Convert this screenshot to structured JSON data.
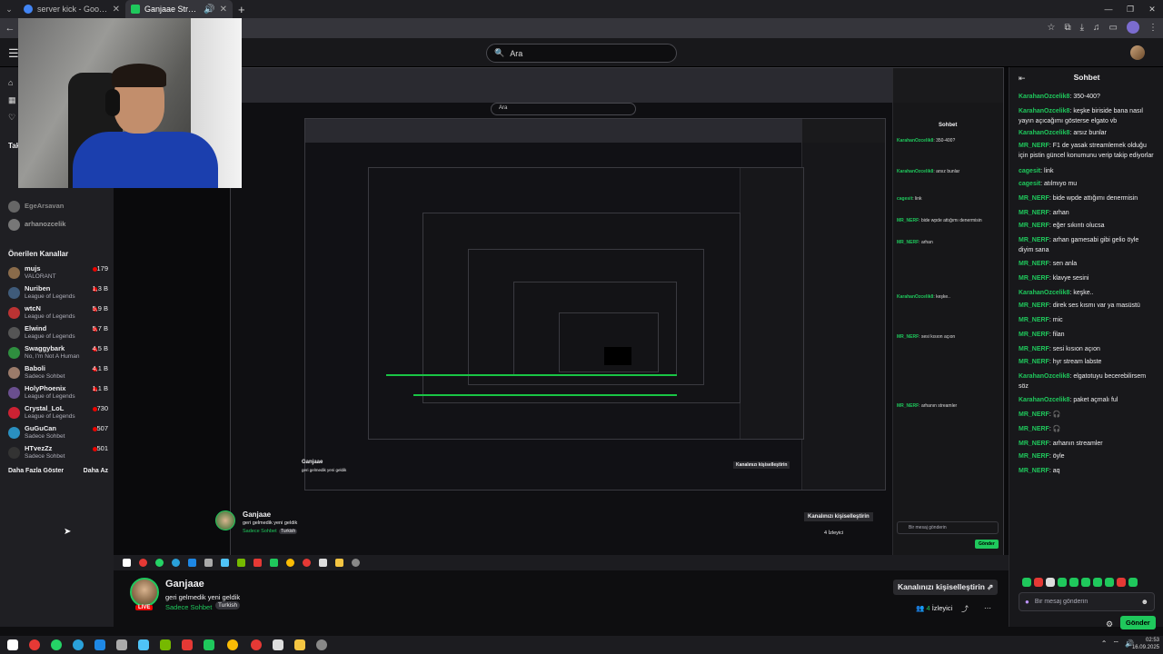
{
  "browser": {
    "tabs": [
      {
        "label": "server kick - Google'da Ara",
        "color": "#4285f4",
        "active": false
      },
      {
        "label": "Ganjaae Stream - Watch Live",
        "color": "#1fc85c",
        "active": true
      }
    ],
    "new_tab": "+",
    "win_minimize": "—",
    "win_maximize": "❐",
    "win_close": "✕"
  },
  "topbar": {
    "search_placeholder": "Ara"
  },
  "sidebar": {
    "following_heading": "Tak",
    "followed": [
      {
        "name": "EgeArsavan",
        "color": "#888"
      },
      {
        "name": "arhanozcelik",
        "color": "#999"
      }
    ],
    "recommended_heading": "Önerilen Kanallar",
    "channels": [
      {
        "name": "mujs",
        "category": "VALORANT",
        "viewers": "179",
        "color": "#8a6b4a"
      },
      {
        "name": "Nuriben",
        "category": "League of Legends",
        "viewers": "1,3 B",
        "color": "#3f5b7a"
      },
      {
        "name": "wtcN",
        "category": "League of Legends",
        "viewers": "5,9 B",
        "color": "#b33"
      },
      {
        "name": "Elwind",
        "category": "League of Legends",
        "viewers": "5,7 B",
        "color": "#555"
      },
      {
        "name": "Swaggybark",
        "category": "No, I'm Not A Human",
        "viewers": "4,5 B",
        "color": "#2f8f3f"
      },
      {
        "name": "Baboli",
        "category": "Sadece Sohbet",
        "viewers": "4,1 B",
        "color": "#9b7b6a"
      },
      {
        "name": "HolyPhoenix",
        "category": "League of Legends",
        "viewers": "1,1 B",
        "color": "#6a4f8f"
      },
      {
        "name": "Crystal_LoL",
        "category": "League of Legends",
        "viewers": "730",
        "color": "#c23"
      },
      {
        "name": "GuGuCan",
        "category": "Sadece Sohbet",
        "viewers": "507",
        "color": "#2a8fbf"
      },
      {
        "name": "HTvezZz",
        "category": "Sadece Sohbet",
        "viewers": "501",
        "color": "#333"
      }
    ],
    "show_more": "Daha Fazla Göster",
    "show_less": "Daha Az"
  },
  "stream_inner": {
    "search": "Ara",
    "chat_head": "Sohbet",
    "channel_name": "Ganjaae",
    "title": "geri gelmedik yeni geldik",
    "category": "Sadece Sohbet",
    "tag": "Turkish",
    "customize": "Kanalınızı kişiselleştirin",
    "viewers": "4 İzleyici",
    "input_placeholder": "Bir mesaj gönderin",
    "send": "Gönder"
  },
  "channel_info": {
    "name": "Ganjaae",
    "title": "geri gelmedik yeni geldik",
    "category": "Sadece Sohbet",
    "tag": "Turkish",
    "live": "LIVE",
    "customize_button": "Kanalınızı kişiselleştirin ⇗",
    "viewer_count": "4",
    "viewer_label": "İzleyici"
  },
  "chat": {
    "heading": "Sohbet",
    "messages": [
      {
        "user": "KarahanOzcelik8",
        "text": "350-400?"
      },
      {
        "user": "KarahanOzcelik8",
        "text": "keşke biriside bana nasıl yayın açıcağımı gösterse elgato vb"
      },
      {
        "user": "KarahanOzcelik8",
        "text": "arsız bunlar"
      },
      {
        "user": "MR_NERF",
        "text": "F1 de yasak streamlemek olduğu için pistin güncel konumunu verip takip ediyorlar"
      },
      {
        "user": "cagesit",
        "text": "link"
      },
      {
        "user": "cagesit",
        "text": "atılmıyo mu"
      },
      {
        "user": "MR_NERF",
        "text": "bide wpde attığımı denermisin"
      },
      {
        "user": "MR_NERF",
        "text": "arhan"
      },
      {
        "user": "MR_NERF",
        "text": "eğer sıkıntı olucsa"
      },
      {
        "user": "MR_NERF",
        "text": "arhan gamesabi gibi gelio öyle diyim sana"
      },
      {
        "user": "MR_NERF",
        "text": "sen anla"
      },
      {
        "user": "MR_NERF",
        "text": "klavye sesini"
      },
      {
        "user": "KarahanOzcelik8",
        "text": "keşke.."
      },
      {
        "user": "MR_NERF",
        "text": "direk ses kısmı var ya masüstü"
      },
      {
        "user": "MR_NERF",
        "text": "mic"
      },
      {
        "user": "MR_NERF",
        "text": "filan"
      },
      {
        "user": "MR_NERF",
        "text": "sesi kısıon açıon"
      },
      {
        "user": "MR_NERF",
        "text": "hyr stream labste"
      },
      {
        "user": "KarahanOzcelik8",
        "text": "elgatotuyu becerebilirsem söz"
      },
      {
        "user": "KarahanOzcelik8",
        "text": "paket açmalı ful"
      },
      {
        "user": "MR_NERF",
        "text": "🎧"
      },
      {
        "user": "MR_NERF",
        "text": "🎧"
      },
      {
        "user": "MR_NERF",
        "text": "arhanın streamler"
      },
      {
        "user": "MR_NERF",
        "text": "öyle"
      },
      {
        "user": "MR_NERF",
        "text": "aq"
      }
    ],
    "input_placeholder": "Bir mesaj gönderin",
    "send_button": "Gönder"
  },
  "taskbar": {
    "time": "02:53",
    "date": "16.09.2025"
  }
}
